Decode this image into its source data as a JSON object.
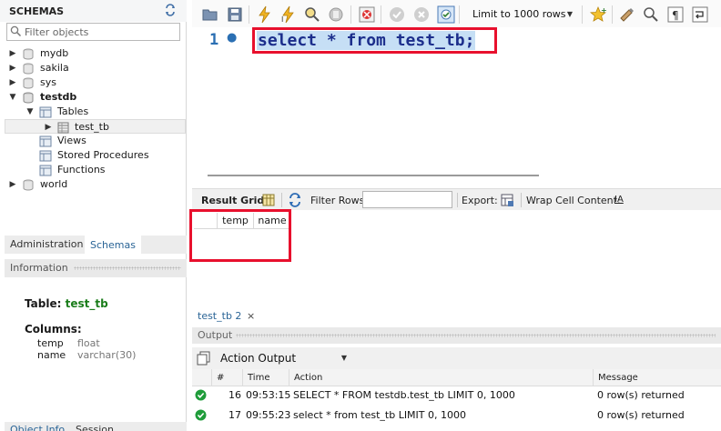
{
  "colors": {
    "highlight_border": "#e8102d",
    "success": "#1f9c3a",
    "sql_keyword": "#1c2e8c",
    "selection": "#c6dff5"
  },
  "sidebar": {
    "title": "SCHEMAS",
    "filter_placeholder": "Filter objects",
    "schemas": [
      {
        "name": "mydb",
        "expanded": false
      },
      {
        "name": "sakila",
        "expanded": false
      },
      {
        "name": "sys",
        "expanded": false
      },
      {
        "name": "testdb",
        "expanded": true,
        "bold": true
      },
      {
        "name": "world",
        "expanded": false
      }
    ],
    "testdb_children": {
      "tables": "Tables",
      "table_item": "test_tb",
      "views": "Views",
      "procedures": "Stored Procedures",
      "functions": "Functions"
    },
    "tabs": {
      "administration": "Administration",
      "schemas": "Schemas"
    },
    "info_title": "Information",
    "info": {
      "table_label": "Table:",
      "table_name": "test_tb",
      "columns_label": "Columns:",
      "columns": [
        {
          "name": "temp",
          "type": "float"
        },
        {
          "name": "name",
          "type": "varchar(30)"
        }
      ]
    },
    "bottom_tabs": {
      "object_info": "Object Info",
      "session": "Session"
    }
  },
  "toolbar": {
    "limit_value": "Limit to 1000 rows",
    "icons": [
      "open-file-icon",
      "save-icon",
      "execute-icon",
      "execute-current-icon",
      "explain-icon",
      "stop-icon",
      "toggle-error-icon",
      "commit-icon",
      "rollback-icon",
      "autocommit-icon",
      "favorite-icon",
      "beautify-icon",
      "find-icon",
      "invisible-chars-icon",
      "wrap-icon"
    ]
  },
  "editor": {
    "line_number": "1",
    "sql": "select * from test_tb;"
  },
  "result_bar": {
    "result_grid": "Result Grid",
    "filter_rows": "Filter Rows:",
    "export": "Export:",
    "wrap_cell": "Wrap Cell Content:",
    "wrap_icon_glyph": "IA"
  },
  "grid": {
    "columns": [
      "temp",
      "name"
    ],
    "rows": []
  },
  "results_tab": {
    "label": "test_tb 2",
    "close": "×"
  },
  "output": {
    "title": "Output",
    "mode": "Action Output",
    "headers": {
      "num": "#",
      "time": "Time",
      "action": "Action",
      "message": "Message"
    },
    "rows": [
      {
        "status": "ok",
        "num": "16",
        "time": "09:53:15",
        "action": "SELECT * FROM testdb.test_tb LIMIT 0, 1000",
        "message": "0 row(s) returned"
      },
      {
        "status": "ok",
        "num": "17",
        "time": "09:55:23",
        "action": "select * from test_tb LIMIT 0, 1000",
        "message": "0 row(s) returned"
      }
    ]
  }
}
